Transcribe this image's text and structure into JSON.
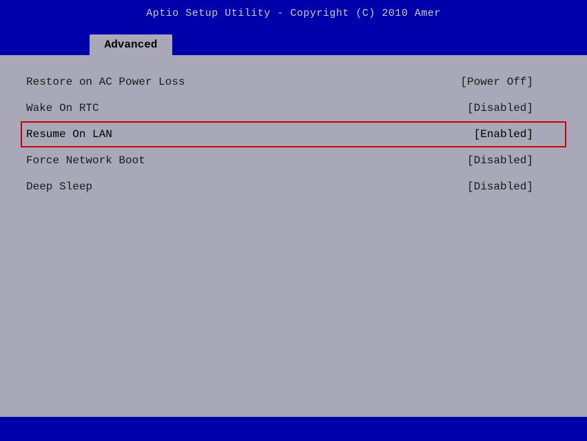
{
  "header": {
    "title": "Aptio Setup Utility - Copyright (C) 2010 Amer"
  },
  "tabs": [
    {
      "label": "Advanced",
      "active": true
    }
  ],
  "menu": {
    "items": [
      {
        "label": "Restore on AC Power Loss",
        "value": "[Power Off]",
        "selected": false
      },
      {
        "label": "Wake On RTC",
        "value": "[Disabled]",
        "selected": false
      },
      {
        "label": "Resume On LAN",
        "value": "[Enabled]",
        "selected": true
      },
      {
        "label": "Force Network Boot",
        "value": "[Disabled]",
        "selected": false
      },
      {
        "label": "Deep Sleep",
        "value": "[Disabled]",
        "selected": false
      }
    ]
  },
  "status_bar": {
    "hints": []
  }
}
